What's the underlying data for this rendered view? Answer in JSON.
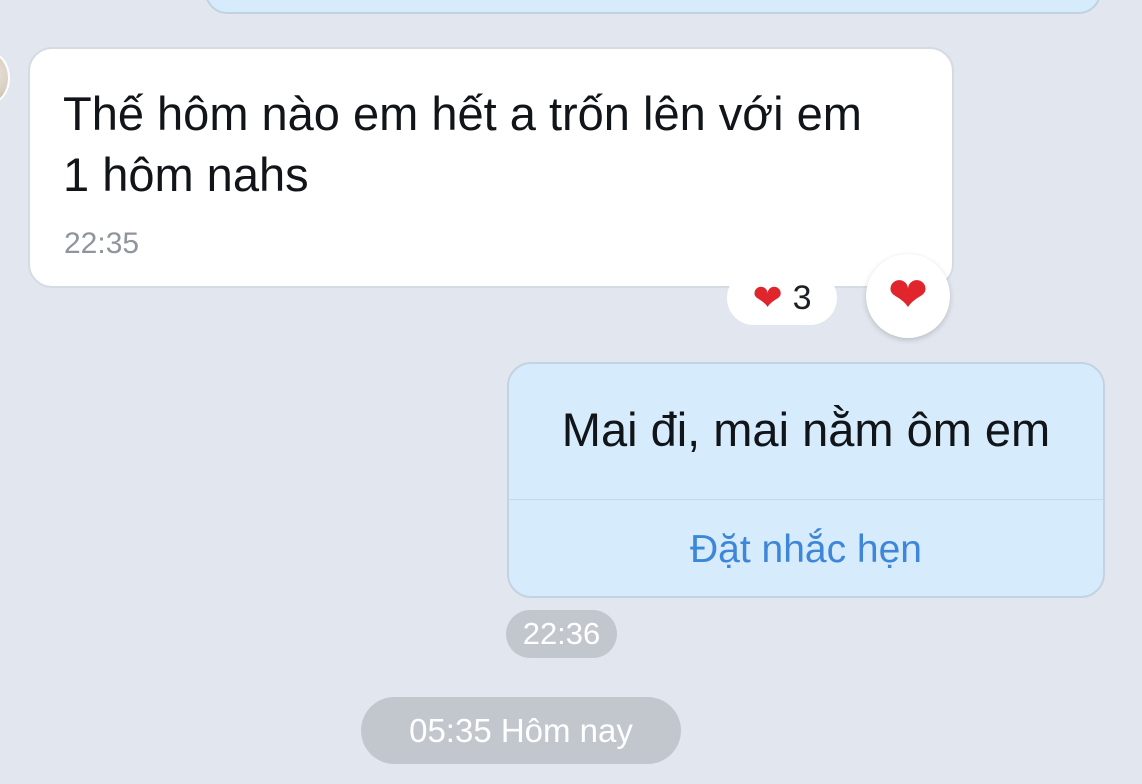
{
  "messages": {
    "incoming": {
      "text_line1": "Thế hôm nào em hết a trốn lên với em",
      "text_line2": "1 hôm nahs",
      "time": "22:35",
      "reaction_summary": {
        "icon": "heart-icon",
        "count": "3"
      },
      "reaction_button": {
        "icon": "heart-icon"
      }
    },
    "outgoing": {
      "text": "Mai đi, mai nằm ôm em",
      "action_label": "Đặt nhắc hẹn",
      "time": "22:36"
    }
  },
  "date_divider": "05:35 Hôm nay",
  "colors": {
    "background": "#e2e7ef",
    "outgoing_bubble": "#d6ebfb",
    "incoming_bubble": "#ffffff",
    "action_link": "#3d86d8",
    "reaction_heart": "#e0252d"
  }
}
